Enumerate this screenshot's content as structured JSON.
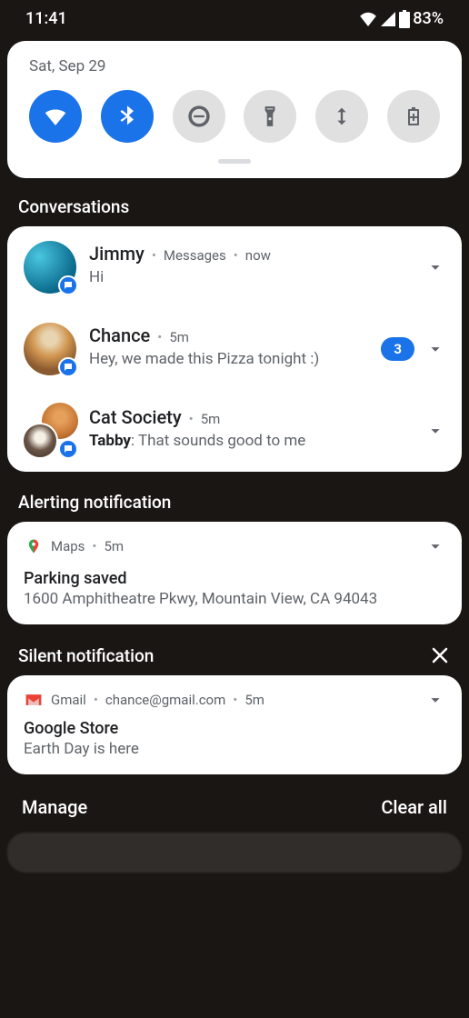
{
  "status_bar": {
    "time": "11:41",
    "battery_pct": "83%"
  },
  "quick_settings": {
    "date": "Sat, Sep 29",
    "tiles": [
      "wifi",
      "bluetooth",
      "dnd",
      "flashlight",
      "autorotate",
      "battery-saver"
    ]
  },
  "sections": {
    "conversations": {
      "title": "Conversations",
      "items": [
        {
          "name": "Jimmy",
          "app": "Messages",
          "time": "now",
          "message": "Hi"
        },
        {
          "name": "Chance",
          "time": "5m",
          "message": "Hey, we made this Pizza tonight :)",
          "count": "3"
        },
        {
          "name": "Cat Society",
          "time": "5m",
          "sender": "Tabby",
          "message": "That sounds good to me"
        }
      ]
    },
    "alerting": {
      "title": "Alerting notification",
      "item": {
        "app": "Maps",
        "time": "5m",
        "headline": "Parking saved",
        "text": "1600 Amphitheatre Pkwy, Mountain View, CA 94043"
      }
    },
    "silent": {
      "title": "Silent notification",
      "item": {
        "app": "Gmail",
        "account": "chance@gmail.com",
        "time": "5m",
        "headline": "Google Store",
        "text": "Earth Day is here"
      }
    }
  },
  "bottom": {
    "manage": "Manage",
    "clear": "Clear all"
  }
}
